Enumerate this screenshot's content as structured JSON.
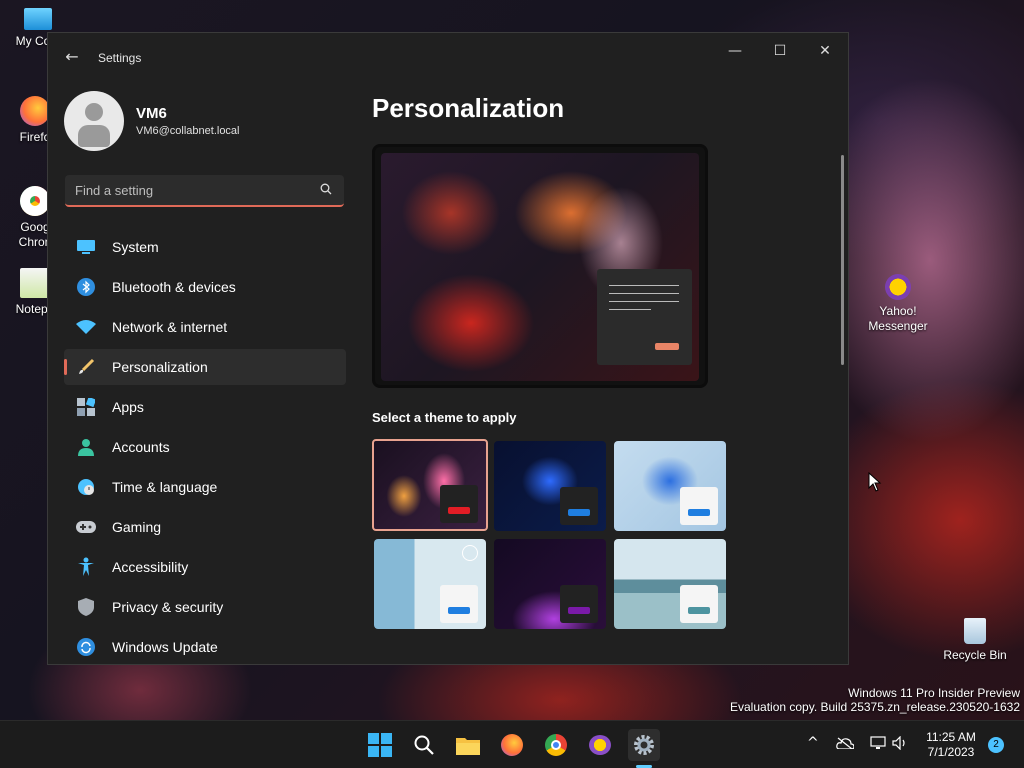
{
  "desktop": {
    "icons": [
      {
        "label": "My Com"
      },
      {
        "label": "Firefo"
      },
      {
        "label": "Goog\nChron"
      },
      {
        "label": "Notepa"
      },
      {
        "label": "Yahoo!\nMessenger"
      },
      {
        "label": "Recycle Bin"
      }
    ],
    "watermark": {
      "line1": "Windows 11 Pro Insider Preview",
      "line2": "Evaluation copy. Build 25375.zn_release.230520-1632"
    }
  },
  "window": {
    "title": "Settings",
    "controls": {
      "minimize": "—",
      "maximize": "☐",
      "close": "✕"
    }
  },
  "profile": {
    "name": "VM6",
    "email": "VM6@collabnet.local"
  },
  "search": {
    "placeholder": "Find a setting"
  },
  "nav": {
    "items": [
      {
        "label": "System",
        "icon": "monitor-icon"
      },
      {
        "label": "Bluetooth & devices",
        "icon": "bluetooth-icon"
      },
      {
        "label": "Network & internet",
        "icon": "wifi-icon"
      },
      {
        "label": "Personalization",
        "icon": "brush-icon",
        "active": true
      },
      {
        "label": "Apps",
        "icon": "apps-icon"
      },
      {
        "label": "Accounts",
        "icon": "person-icon"
      },
      {
        "label": "Time & language",
        "icon": "globe-clock-icon"
      },
      {
        "label": "Gaming",
        "icon": "gamepad-icon"
      },
      {
        "label": "Accessibility",
        "icon": "accessibility-icon"
      },
      {
        "label": "Privacy & security",
        "icon": "shield-icon"
      },
      {
        "label": "Windows Update",
        "icon": "update-icon"
      }
    ]
  },
  "content": {
    "title": "Personalization",
    "theme_heading": "Select a theme to apply",
    "accent_color": "#e06a58"
  },
  "taskbar": {
    "clock": {
      "time": "11:25 AM",
      "date": "7/1/2023"
    },
    "notifications": "2",
    "tray_chevron": "^"
  }
}
